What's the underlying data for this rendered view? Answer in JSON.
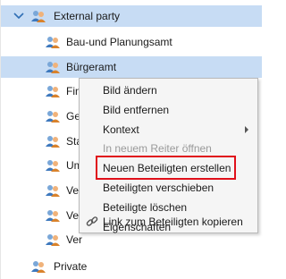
{
  "tree": {
    "root": {
      "label": "External party",
      "expanded": true
    },
    "children": [
      {
        "label": "Bau-und Planungsamt",
        "selected": false
      },
      {
        "label": "Bürgeramt",
        "selected": true
      },
      {
        "label": "Fin",
        "selected": false
      },
      {
        "label": "Ge",
        "selected": false
      },
      {
        "label": "Sta",
        "selected": false
      },
      {
        "label": "Um",
        "selected": false
      },
      {
        "label": "Ver",
        "selected": false
      },
      {
        "label": "Ver",
        "selected": false
      },
      {
        "label": "Ver",
        "selected": false
      }
    ],
    "sibling": {
      "label": "Private"
    }
  },
  "context_menu": {
    "items": [
      {
        "label": "Bild ändern",
        "enabled": true
      },
      {
        "label": "Bild entfernen",
        "enabled": true
      },
      {
        "label": "Kontext",
        "enabled": true,
        "submenu": true
      },
      {
        "label": "In neuem Reiter öffnen",
        "enabled": false
      },
      {
        "label": "Neuen Beteiligten erstellen",
        "enabled": true,
        "highlighted": true
      },
      {
        "label": "Beteiligten verschieben",
        "enabled": true
      },
      {
        "label": "Beteiligte löschen",
        "enabled": true
      },
      {
        "label": "Eigenschaften",
        "enabled": true
      },
      {
        "label": "Link zum Beteiligten kopieren",
        "enabled": true,
        "icon": "link-icon"
      }
    ]
  },
  "colors": {
    "selection": "#c7dcf4",
    "highlight_border": "#e0101a",
    "chevron": "#2f6fb5"
  }
}
